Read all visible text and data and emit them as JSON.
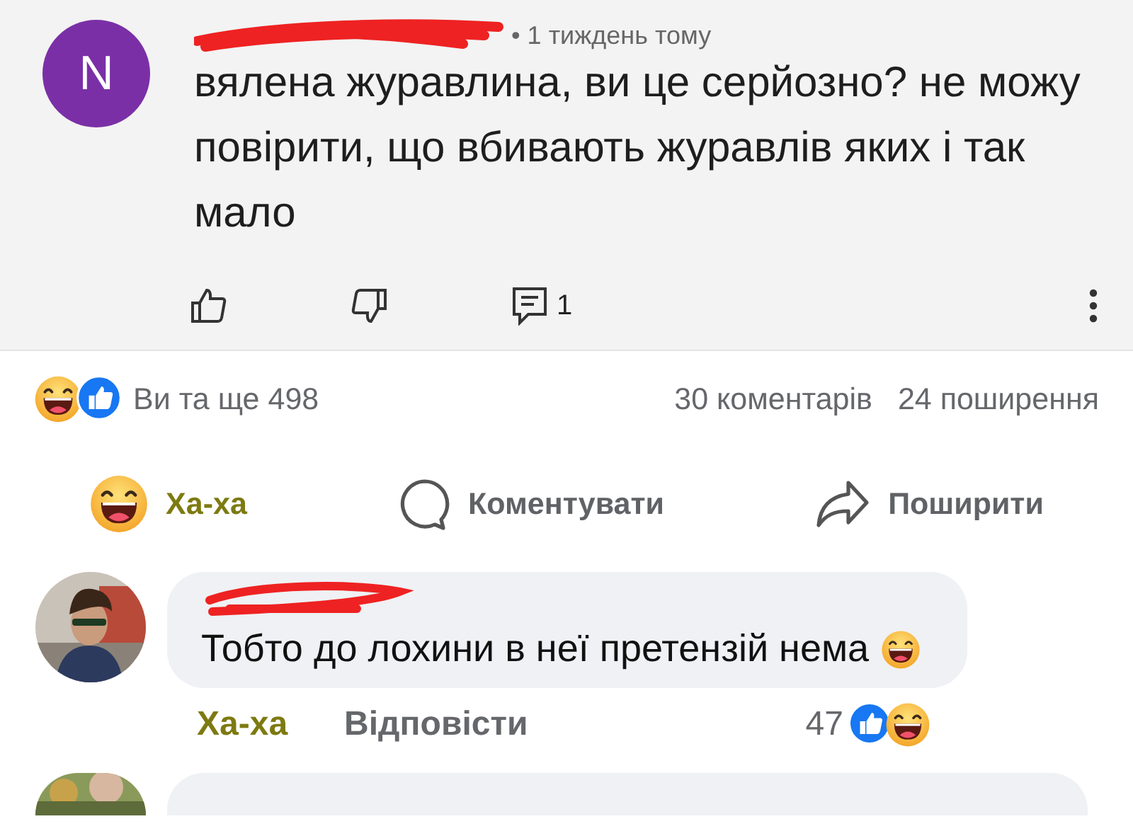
{
  "shared_comment": {
    "avatar_letter": "N",
    "time": "• 1 тиждень тому",
    "text": "вялена журавлина, ви це серйозно? не можу повірити, що вбивають журавлів яких і так мало",
    "reply_count": "1"
  },
  "reactions_summary": {
    "text": "Ви та ще 498",
    "comments": "30 коментарів",
    "shares": "24 поширення"
  },
  "actions": [
    {
      "kind": "reaction",
      "label": "Ха-ха",
      "selected": true
    },
    {
      "kind": "comment",
      "label": "Коментувати",
      "selected": false
    },
    {
      "kind": "share",
      "label": "Поширити",
      "selected": false
    }
  ],
  "comments": [
    {
      "text": "Тобто до лохини в неї претензій нема",
      "reaction": "Ха-ха",
      "reacted": true,
      "reply": "Відповісти",
      "reaction_count": "47"
    }
  ]
}
